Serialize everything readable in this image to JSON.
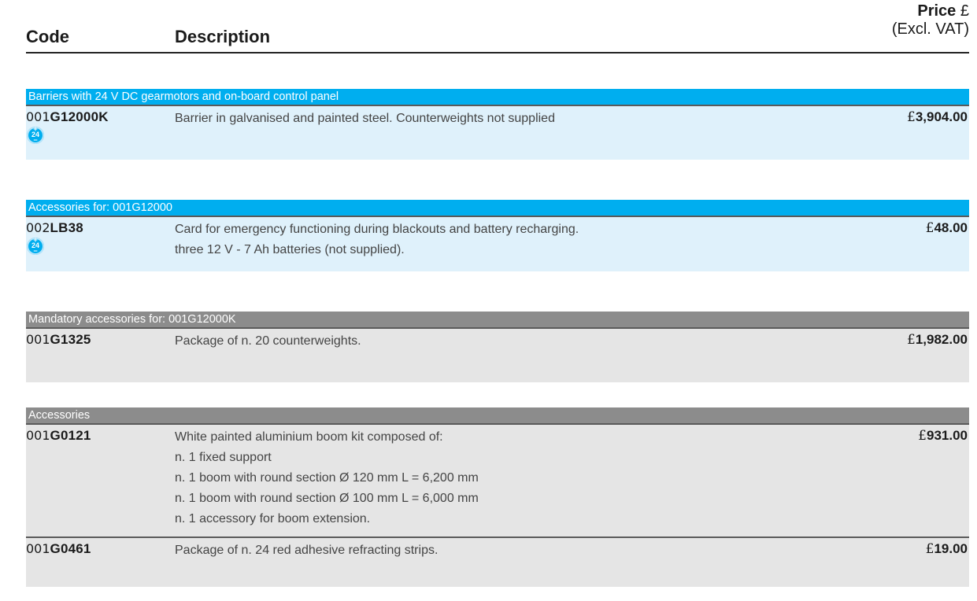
{
  "header": {
    "code": "Code",
    "description": "Description",
    "price_label": "Price",
    "price_currency": "£",
    "price_note": "(Excl. VAT)"
  },
  "badge": {
    "plus": "+",
    "number": "24",
    "minus": "−"
  },
  "sections": [
    {
      "title": "Barriers with 24 V DC gearmotors and on-board control panel",
      "rows": [
        {
          "code_prefix": "001",
          "code_main": "G12000K",
          "lines": [
            "Barrier in galvanised and painted steel. Counterweights not supplied"
          ],
          "currency": "£",
          "price": "3,904.00"
        }
      ]
    },
    {
      "title": "Accessories for: 001G12000",
      "rows": [
        {
          "code_prefix": "002",
          "code_main": "LB38",
          "lines": [
            "Card for emergency functioning during blackouts and battery recharging.",
            "three 12 V - 7 Ah batteries (not supplied)."
          ],
          "currency": "£",
          "price": "48.00"
        }
      ]
    },
    {
      "title": "Mandatory accessories for: 001G12000K",
      "rows": [
        {
          "code_prefix": "001",
          "code_main": "G1325",
          "lines": [
            "Package of n. 20 counterweights."
          ],
          "currency": "£",
          "price": "1,982.00"
        }
      ]
    },
    {
      "title": "Accessories",
      "rows": [
        {
          "code_prefix": "001",
          "code_main": "G0121",
          "lines": [
            "White painted aluminium boom kit composed of:",
            "n. 1 fixed support",
            "n. 1 boom with round section Ø 120 mm L = 6,200 mm",
            "n. 1 boom with round section Ø 100 mm L = 6,000 mm",
            "n. 1 accessory for boom extension."
          ],
          "currency": "£",
          "price": "931.00"
        },
        {
          "code_prefix": "001",
          "code_main": "G0461",
          "lines": [
            "Package of n. 24 red adhesive refracting strips."
          ],
          "currency": "£",
          "price": "19.00"
        }
      ]
    }
  ]
}
